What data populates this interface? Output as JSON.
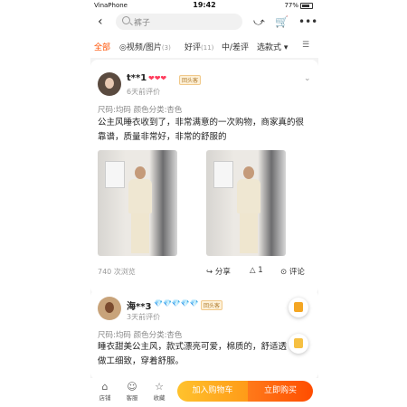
{
  "status": {
    "carrier": "VinaPhone",
    "time": "19:42",
    "battery": "77%"
  },
  "search": {
    "query": "裤子"
  },
  "tabs": [
    {
      "label": "全部",
      "count": ""
    },
    {
      "label": "◎视频/图片",
      "count": "(3)"
    },
    {
      "label": "好评",
      "count": "(11)"
    },
    {
      "label": "中/差评",
      "count": ""
    },
    {
      "label": "选款式 ▾",
      "count": ""
    }
  ],
  "review1": {
    "user": "t**1",
    "hearts": "❤❤❤",
    "badge": "回头客",
    "time": "6天前评价",
    "spec": "尺码:均码 颜色分类:杏色",
    "text_line1": "公主风睡衣收到了，非常满意的一次购物，商家真的很",
    "text_line2": "靠谱，质量非常好，非常的舒服的",
    "views": "740 次浏览",
    "share": "分享",
    "likes": "1",
    "comment": "评论"
  },
  "review2": {
    "user": "海**3",
    "diamonds": "💎💎💎💎💎",
    "badge": "回头客",
    "time": "3天前评价",
    "spec": "尺码:均码 颜色分类:杏色",
    "text_line1": "睡衣甜美公主风，款式漂亮可爱，棉质的，舒适透",
    "text_line2": "做工细致，穿着舒服。"
  },
  "bottom": {
    "shop": "店铺",
    "service": "客服",
    "favorite": "收藏",
    "add_cart": "加入购物车",
    "buy_now": "立即购买"
  }
}
